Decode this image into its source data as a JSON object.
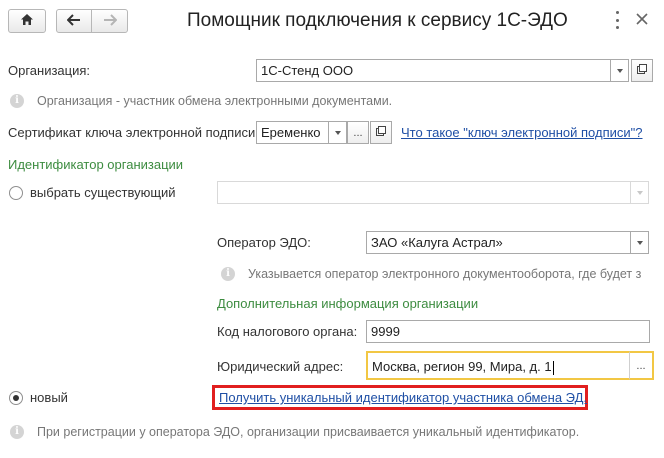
{
  "window": {
    "title": "Помощник подключения к сервису 1С-ЭДО",
    "menu_icon": "more-vert-icon",
    "close_icon": "close-icon"
  },
  "toolbar": {
    "home_icon": "home-icon",
    "back_icon": "arrow-left-icon",
    "forward_icon": "arrow-right-icon"
  },
  "organization": {
    "label": "Организация:",
    "value": "1С-Стенд ООО",
    "hint": "Организация - участник обмена электронными документами."
  },
  "certificate": {
    "label": "Сертификат ключа электронной подписи:",
    "value": "Еременко",
    "help_link": "Что такое \"ключ электронной подписи\"?"
  },
  "identifier": {
    "section_title": "Идентификатор организации",
    "existing_label": "выбрать существующий",
    "existing_value": "",
    "new_label": "новый",
    "selected": "new"
  },
  "operator": {
    "label": "Оператор ЭДО:",
    "value": "ЗАО «Калуга Астрал»",
    "hint": "Указывается оператор электронного документооборота, где будет з"
  },
  "additional": {
    "section_title": "Дополнительная информация организации",
    "tax_label": "Код налогового органа:",
    "tax_value": "9999",
    "address_label": "Юридический адрес:",
    "address_value": "Москва, регион 99, Мира, д. 1"
  },
  "actions": {
    "get_id_link": "Получить уникальный идентификатор участника обмена ЭД."
  },
  "footer": {
    "hint": "При регистрации у оператора ЭДО, организации присваивается уникальный идентификатор."
  },
  "colors": {
    "accent_green": "#3d8c40",
    "link_blue": "#1f4fa5",
    "highlight_red": "#e11f1f",
    "focus_yellow": "#f2c744"
  }
}
